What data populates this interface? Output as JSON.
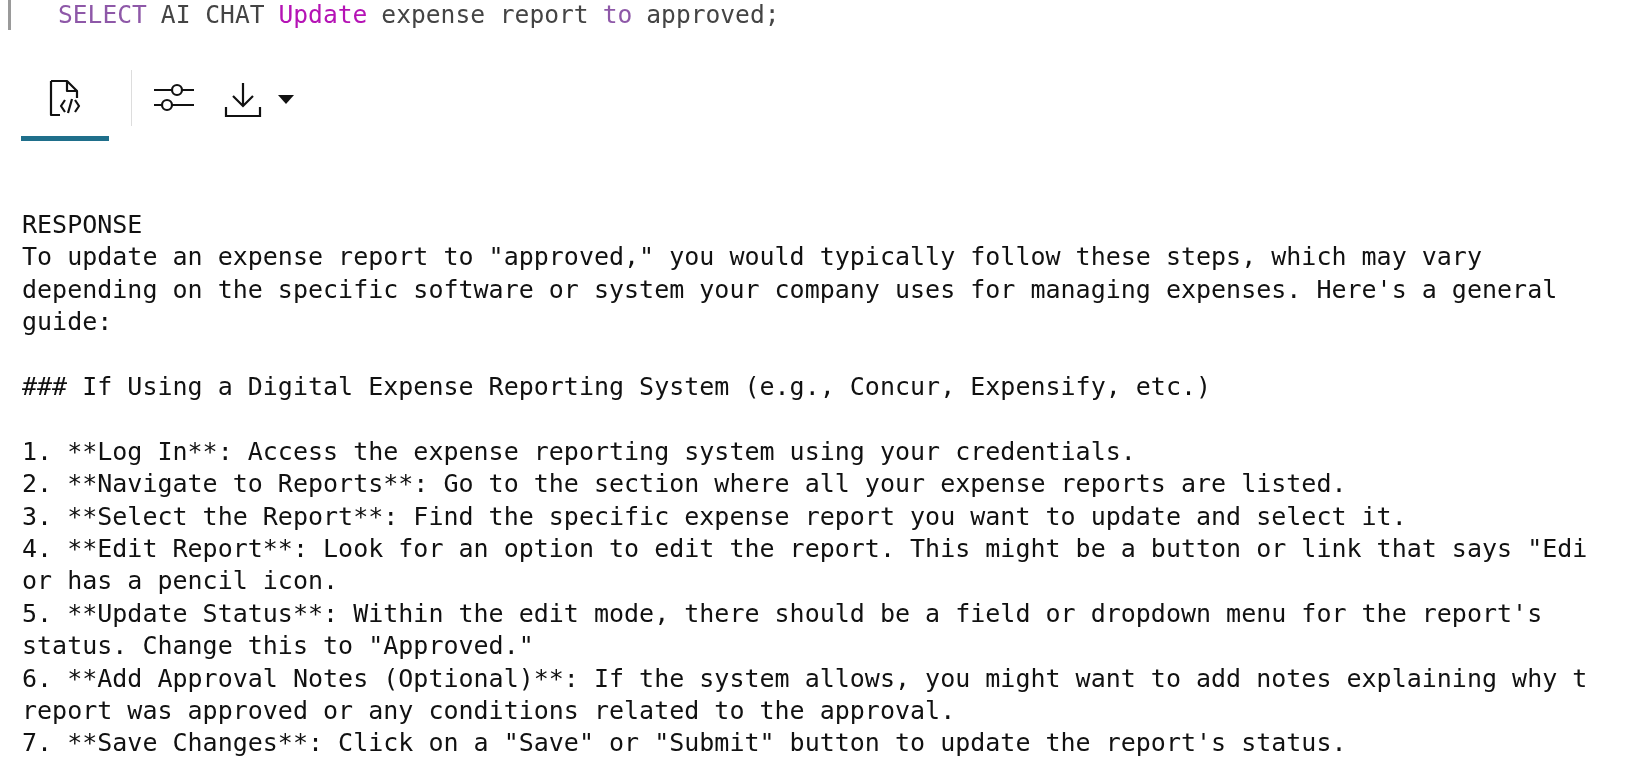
{
  "query": {
    "tokens": [
      {
        "text": "SELECT",
        "kind": "keyword"
      },
      {
        "text": "AI CHAT",
        "kind": "plain"
      },
      {
        "text": "Update",
        "kind": "command"
      },
      {
        "text": "expense report",
        "kind": "plain"
      },
      {
        "text": "to",
        "kind": "keyword"
      },
      {
        "text": "approved;",
        "kind": "plain"
      }
    ]
  },
  "toolbar": {
    "items": [
      {
        "kind": "tab",
        "selected": true
      },
      {
        "kind": "divider"
      },
      {
        "kind": "settings"
      },
      {
        "kind": "download"
      }
    ]
  },
  "response": {
    "label": "RESPONSE",
    "paragraphs": [
      {
        "lines": [
          "To update an expense report to \"approved,\" you would typically follow these steps, which may vary",
          "depending on the specific software or system your company uses for managing expenses. Here's a general",
          "guide:"
        ]
      },
      {
        "lines": [
          "### If Using a Digital Expense Reporting System (e.g., Concur, Expensify, etc.)"
        ]
      },
      {
        "lines": [
          "1. **Log In**: Access the expense reporting system using your credentials.",
          "2. **Navigate to Reports**: Go to the section where all your expense reports are listed.",
          "3. **Select the Report**: Find the specific expense report you want to update and select it.",
          "4. **Edit Report**: Look for an option to edit the report. This might be a button or link that says \"Edi",
          "or has a pencil icon.",
          "5. **Update Status**: Within the edit mode, there should be a field or dropdown menu for the report's",
          "status. Change this to \"Approved.\"",
          "6. **Add Approval Notes (Optional)**: If the system allows, you might want to add notes explaining why t",
          "report was approved or any conditions related to the approval.",
          "7. **Save Changes**: Click on a \"Save\" or \"Submit\" button to update the report's status."
        ]
      }
    ]
  }
}
